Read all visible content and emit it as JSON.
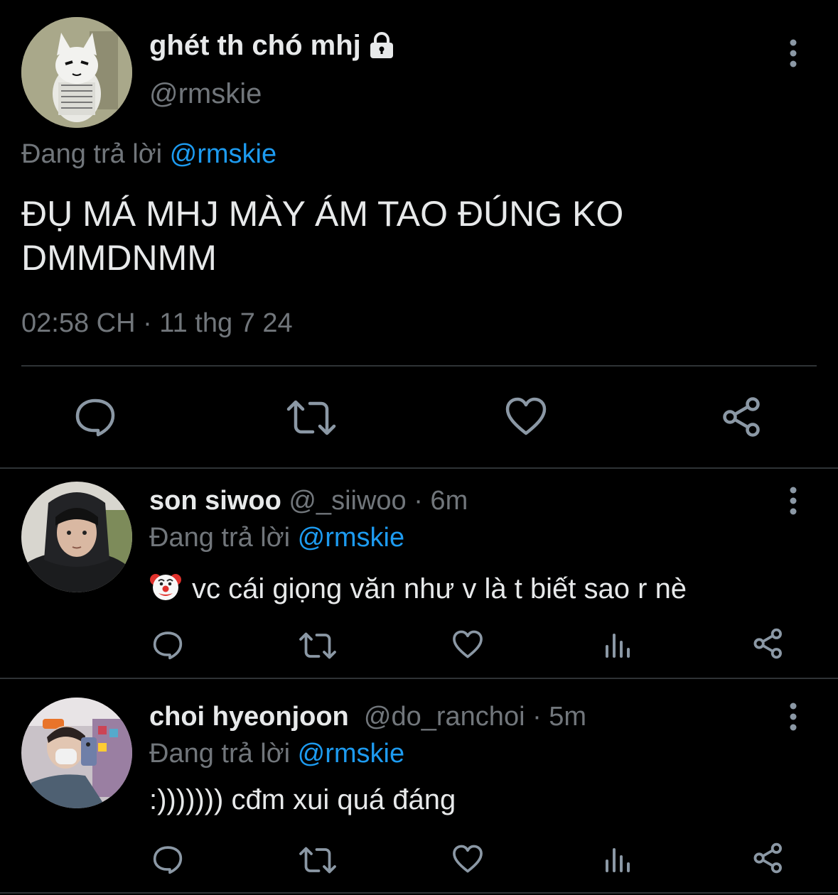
{
  "main_tweet": {
    "author_name": "ghét th chó mhj",
    "author_handle": "@rmskie",
    "reply_prefix": "Đang trả lời ",
    "reply_to": "@rmskie",
    "text_line1": "ĐỤ MÁ MHJ MÀY ÁM TAO ĐÚNG KO",
    "text_line2": "DMMDNMM",
    "timestamp": "02:58 CH · 11 thg 7 24",
    "actions": [
      "reply-icon",
      "retweet-icon",
      "like-icon",
      "share-icon"
    ]
  },
  "replies": [
    {
      "name": "son siwoo",
      "handle_time": "@_siiwoo · 6m",
      "reply_prefix": "Đang trả lời ",
      "reply_to": "@rmskie",
      "emoji": "clown-face-icon",
      "text": "vc cái giọng văn như v là t biết sao r nè"
    },
    {
      "name": "choi hyeonjoon",
      "handle_time": "@do_ranchoi · 5m",
      "reply_prefix": "Đang trả lời ",
      "reply_to": "@rmskie",
      "text": ":))))))) cđm xui quá đáng"
    }
  ],
  "colors": {
    "background": "#000000",
    "text": "#e7e9ea",
    "muted": "#71767b",
    "accent": "#1d9bf0",
    "icon": "#8b98a5",
    "divider": "#2f3336"
  }
}
